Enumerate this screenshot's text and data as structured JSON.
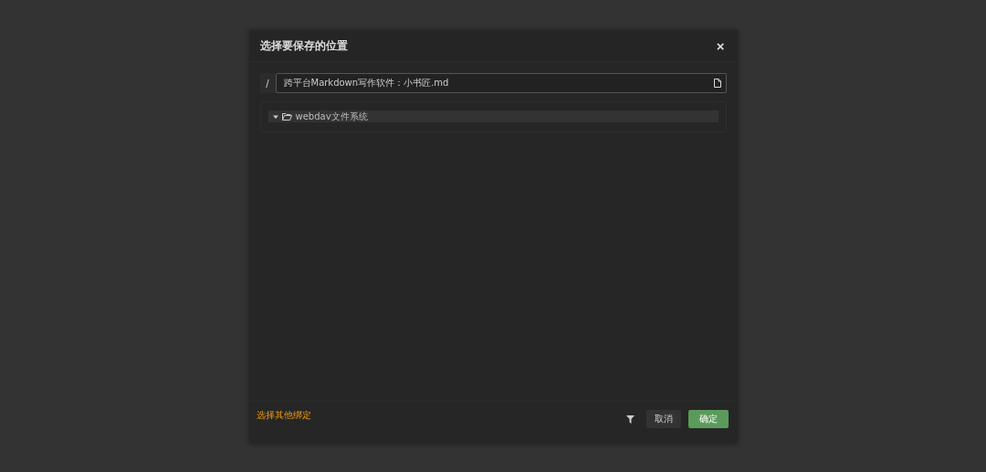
{
  "dialog": {
    "title": "选择要保存的位置",
    "close": "×"
  },
  "path": {
    "prefix": "/",
    "value": "跨平台Markdown写作软件：小书匠.md"
  },
  "tree": [
    {
      "label": "webdav文件系统",
      "expanded": true,
      "selected": true
    }
  ],
  "footer": {
    "link": "选择其他绑定",
    "buttons": [
      {
        "label": "取消",
        "kind": "secondary"
      },
      {
        "label": "确定",
        "kind": "primary"
      }
    ]
  }
}
